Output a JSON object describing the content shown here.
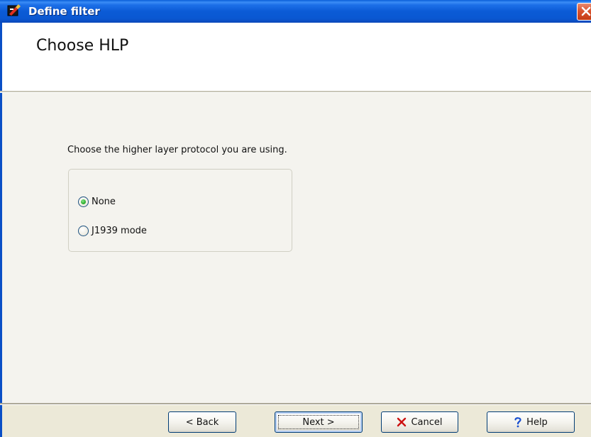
{
  "window": {
    "title": "Define filter"
  },
  "header": {
    "title": "Choose HLP"
  },
  "content": {
    "instruction": "Choose the higher layer protocol you are using.",
    "options": [
      {
        "label": "None",
        "checked": true
      },
      {
        "label": "J1939 mode",
        "checked": false
      }
    ]
  },
  "buttons": {
    "back": "< Back",
    "next": "Next >",
    "cancel": "Cancel",
    "help": "Help"
  },
  "icons": {
    "app": "app-icon",
    "close": "close-icon",
    "cancel": "x-icon",
    "help": "question-icon"
  },
  "colors": {
    "titlebar": "#0b5bd6",
    "close": "#d9532f",
    "cancel_icon": "#cc1111",
    "help_icon": "#1a4fd0",
    "radio_checked": "#33b333"
  }
}
